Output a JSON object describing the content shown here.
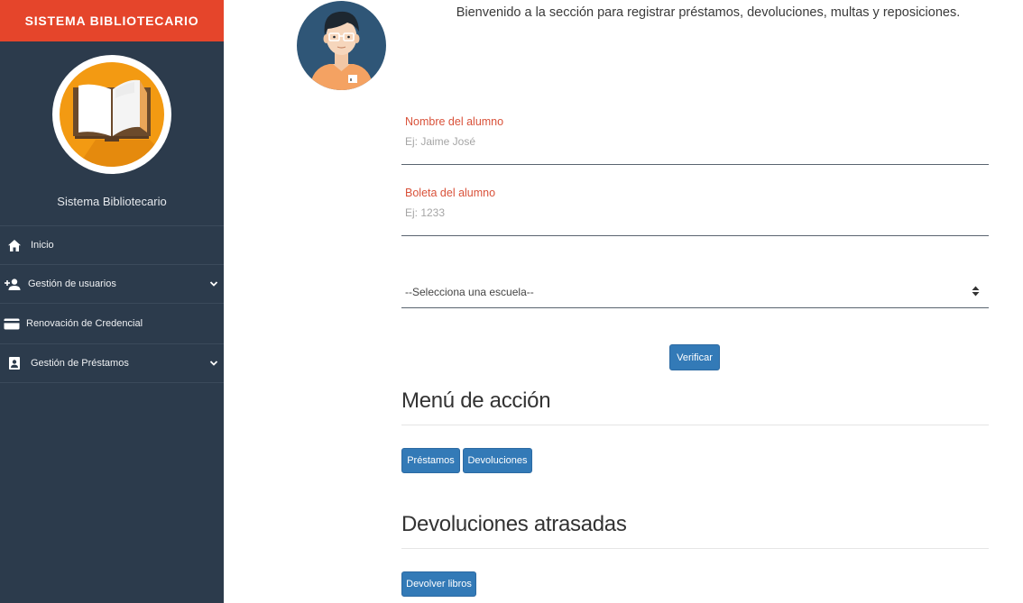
{
  "sidebar": {
    "brand": "SISTEMA BIBLIOTECARIO",
    "system_name": "Sistema Bibliotecario",
    "items": [
      {
        "label": "Inicio",
        "icon": "home-icon",
        "expandable": false
      },
      {
        "label": "Gestión de usuarios",
        "icon": "person-add-icon",
        "expandable": true
      },
      {
        "label": "Renovación de Credencial",
        "icon": "credit-card-icon",
        "expandable": false
      },
      {
        "label": "Gestión de Préstamos",
        "icon": "portrait-icon",
        "expandable": true
      }
    ]
  },
  "main": {
    "welcome": "Bienvenido a la sección para registrar préstamos, devoluciones, multas y reposiciones.",
    "form": {
      "name_label": "Nombre del alumno",
      "name_placeholder": "Ej: Jaime José",
      "boleta_label": "Boleta del alumno",
      "boleta_placeholder": "Ej: 1233",
      "school_select": "--Selecciona una escuela--",
      "verify_button": "Verificar"
    },
    "action_menu": {
      "title": "Menú de acción",
      "buttons": [
        "Préstamos",
        "Devoluciones"
      ]
    },
    "overdue": {
      "title": "Devoluciones atrasadas",
      "button": "Devolver libros"
    }
  },
  "colors": {
    "sidebar_bg": "#2c3b4c",
    "brand_bg": "#e5452b",
    "primary_button": "#337ab7",
    "label_accent": "#d9523a",
    "logo_orange": "#f39a12"
  }
}
